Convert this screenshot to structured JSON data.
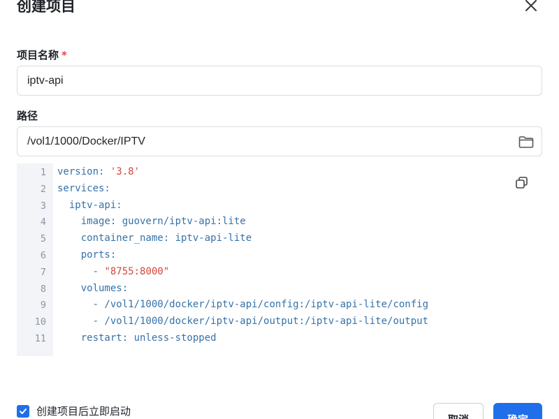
{
  "dialog": {
    "title": "创建项目",
    "close_icon": "close-icon"
  },
  "form": {
    "name_label": "项目名称",
    "required_mark": "*",
    "name_value": "iptv-api",
    "path_label": "路径",
    "path_value": "/vol1/1000/Docker/IPTV",
    "folder_icon": "folder-icon"
  },
  "editor": {
    "copy_icon": "copy-icon",
    "lines": [
      {
        "num": "1",
        "indent": "",
        "key": "version: ",
        "str": "'3.8'"
      },
      {
        "num": "2",
        "indent": "",
        "key": "services:",
        "str": ""
      },
      {
        "num": "3",
        "indent": "  ",
        "key": "iptv-api:",
        "str": ""
      },
      {
        "num": "4",
        "indent": "    ",
        "key": "image: guovern/iptv-api:lite",
        "str": ""
      },
      {
        "num": "5",
        "indent": "    ",
        "key": "container_name: iptv-api-lite",
        "str": ""
      },
      {
        "num": "6",
        "indent": "    ",
        "key": "ports:",
        "str": ""
      },
      {
        "num": "7",
        "indent": "      ",
        "key": "- ",
        "str": "\"8755:8000\""
      },
      {
        "num": "8",
        "indent": "    ",
        "key": "volumes:",
        "str": ""
      },
      {
        "num": "9",
        "indent": "      ",
        "key": "- /vol1/1000/docker/iptv-api/config:/iptv-api-lite/config",
        "str": ""
      },
      {
        "num": "10",
        "indent": "      ",
        "key": "- /vol1/1000/docker/iptv-api/output:/iptv-api-lite/output",
        "str": ""
      },
      {
        "num": "11",
        "indent": "    ",
        "key": "restart: unless-stopped",
        "str": ""
      }
    ]
  },
  "footer": {
    "checkbox_label": "创建项目后立即启动",
    "checkbox_checked": true,
    "cancel_label": "取消",
    "ok_label": "确定"
  },
  "colors": {
    "accent": "#1f6feb",
    "code_key": "#3572a8",
    "code_string": "#d4453a"
  }
}
